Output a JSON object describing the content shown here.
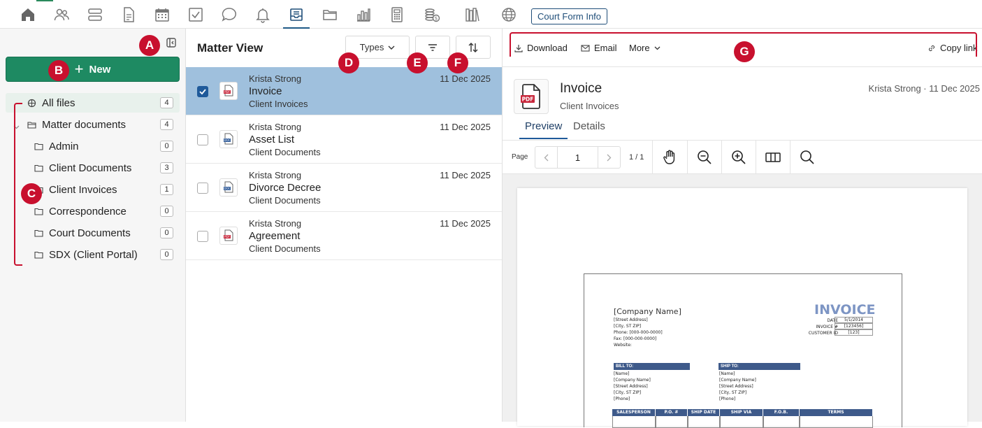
{
  "topbar": {
    "icons": [
      "home-icon",
      "contacts-icon",
      "matters-icon",
      "documents-icon",
      "calendar-icon",
      "tasks-icon",
      "messages-icon",
      "notifications-icon",
      "inbox-icon",
      "folder-icon",
      "reports-icon",
      "calculator-icon",
      "billing-icon",
      "library-icon",
      "globe-icon"
    ],
    "active": "inbox-icon",
    "court_form_label": "Court Form Info"
  },
  "sidebar": {
    "new_label": "New",
    "items": [
      {
        "label": "All files",
        "count": "4",
        "icon": "all-files-icon",
        "selected": true
      },
      {
        "label": "Matter documents",
        "count": "4",
        "icon": "folder-open-icon"
      },
      {
        "label": "Admin",
        "count": "0",
        "icon": "folder-icon"
      },
      {
        "label": "Client Documents",
        "count": "3",
        "icon": "folder-icon"
      },
      {
        "label": "Client Invoices",
        "count": "1",
        "icon": "folder-icon"
      },
      {
        "label": "Correspondence",
        "count": "0",
        "icon": "folder-icon"
      },
      {
        "label": "Court Documents",
        "count": "0",
        "icon": "folder-icon"
      },
      {
        "label": "SDX (Client Portal)",
        "count": "0",
        "icon": "folder-icon"
      }
    ]
  },
  "middle": {
    "title": "Matter View",
    "types_label": "Types",
    "files": [
      {
        "owner": "Krista Strong",
        "name": "Invoice",
        "folder": "Client Invoices",
        "date": "11 Dec 2025",
        "type": "pdf",
        "selected": true
      },
      {
        "owner": "Krista Strong",
        "name": "Asset List",
        "folder": "Client Documents",
        "date": "11 Dec 2025",
        "type": "doc"
      },
      {
        "owner": "Krista Strong",
        "name": "Divorce Decree",
        "folder": "Client Documents",
        "date": "11 Dec 2025",
        "type": "doc"
      },
      {
        "owner": "Krista Strong",
        "name": "Agreement",
        "folder": "Client Documents",
        "date": "11 Dec 2025",
        "type": "pdf"
      }
    ]
  },
  "right": {
    "download_label": "Download",
    "email_label": "Email",
    "more_label": "More",
    "copy_link_label": "Copy link",
    "doc_title": "Invoice",
    "doc_folder": "Client Invoices",
    "doc_meta": "Krista Strong · 11 Dec 2025",
    "tab_preview": "Preview",
    "tab_details": "Details",
    "page_label": "Page",
    "page_value": "1",
    "page_of": "1 / 1"
  },
  "invoice": {
    "company": "[Company Name]",
    "heading": "INVOICE",
    "address_lines": [
      "[Street Address]",
      "[City, ST  ZIP]",
      "Phone: [000-000-0000]",
      "Fax: [000-000-0000]",
      "Website:"
    ],
    "meta_labels": [
      "DATE",
      "INVOICE #",
      "CUSTOMER ID"
    ],
    "meta_values": [
      "5/1/2014",
      "[123456]",
      "[123]"
    ],
    "bill_to": "BILL TO:",
    "ship_to": "SHIP TO:",
    "party_lines": [
      "[Name]",
      "[Company Name]",
      "[Street Address]",
      "[City, ST  ZIP]",
      "[Phone]"
    ],
    "columns": [
      "SALESPERSON",
      "P.O. #",
      "SHIP DATE",
      "SHIP VIA",
      "F.O.B.",
      "TERMS"
    ]
  },
  "callouts": [
    "A",
    "B",
    "C",
    "D",
    "E",
    "F",
    "G"
  ]
}
